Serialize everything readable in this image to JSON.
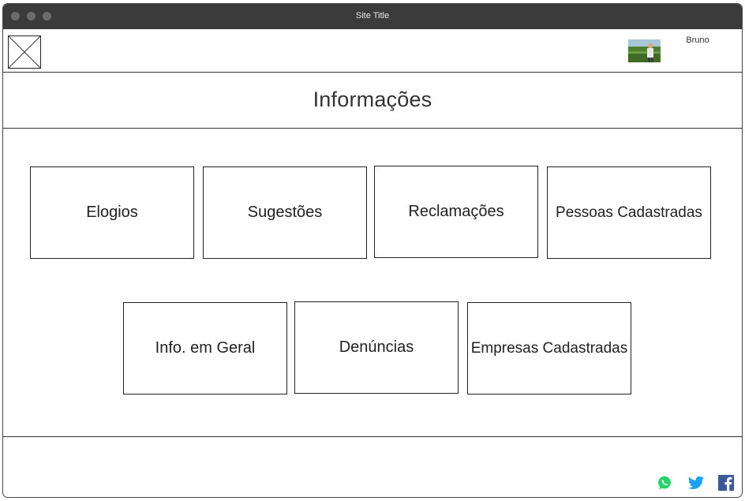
{
  "window": {
    "title": "Site Title"
  },
  "header": {
    "user_name": "Bruno",
    "logo_icon": "image-placeholder-icon",
    "avatar": "user-photo"
  },
  "main": {
    "title": "Informações",
    "cards": [
      {
        "label": "Elogios"
      },
      {
        "label": "Sugestões"
      },
      {
        "label": "Reclamações"
      },
      {
        "label": "Pessoas Cadastradas"
      },
      {
        "label": "Info. em Geral"
      },
      {
        "label": "Denúncias"
      },
      {
        "label": "Empresas Cadastradas"
      }
    ]
  },
  "footer": {
    "social": [
      {
        "icon": "whatsapp-icon",
        "color": "#25D366"
      },
      {
        "icon": "twitter-icon",
        "color": "#1DA1F2"
      },
      {
        "icon": "facebook-icon",
        "color": "#3B5998"
      }
    ]
  }
}
